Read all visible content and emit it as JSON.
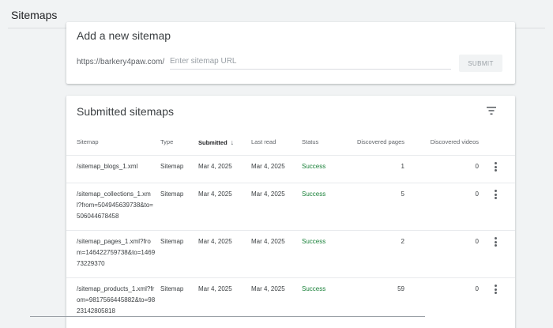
{
  "header": {
    "title": "Sitemaps"
  },
  "add_sitemap": {
    "title": "Add a new sitemap",
    "url_prefix": "https://barkery4paw.com/",
    "input_placeholder": "Enter sitemap URL",
    "input_value": "",
    "submit_label": "SUBMIT"
  },
  "submitted": {
    "title": "Submitted sitemaps",
    "filter_icon": "filter-icon",
    "columns": {
      "sitemap": "Sitemap",
      "type": "Type",
      "submitted": "Submitted",
      "last_read": "Last read",
      "status": "Status",
      "discovered_pages": "Discovered pages",
      "discovered_videos": "Discovered videos"
    },
    "sort_icon": "arrow-down-icon",
    "rows": [
      {
        "sitemap": "/sitemap_blogs_1.xml",
        "type": "Sitemap",
        "submitted": "Mar 4, 2025",
        "last_read": "Mar 4, 2025",
        "status": "Success",
        "pages": "1",
        "videos": "0"
      },
      {
        "sitemap": "/sitemap_collections_1.xml?from=504945639738&to=506044678458",
        "type": "Sitemap",
        "submitted": "Mar 4, 2025",
        "last_read": "Mar 4, 2025",
        "status": "Success",
        "pages": "5",
        "videos": "0"
      },
      {
        "sitemap": "/sitemap_pages_1.xml?from=146422759738&to=146973229370",
        "type": "Sitemap",
        "submitted": "Mar 4, 2025",
        "last_read": "Mar 4, 2025",
        "status": "Success",
        "pages": "2",
        "videos": "0"
      },
      {
        "sitemap": "/sitemap_products_1.xml?from=9817566445882&to=9823142805818",
        "type": "Sitemap",
        "submitted": "Mar 4, 2025",
        "last_read": "Mar 4, 2025",
        "status": "Success",
        "pages": "59",
        "videos": "0"
      }
    ]
  },
  "colors": {
    "status_success": "#188038",
    "background": "#f1f3f4",
    "card": "#ffffff"
  }
}
